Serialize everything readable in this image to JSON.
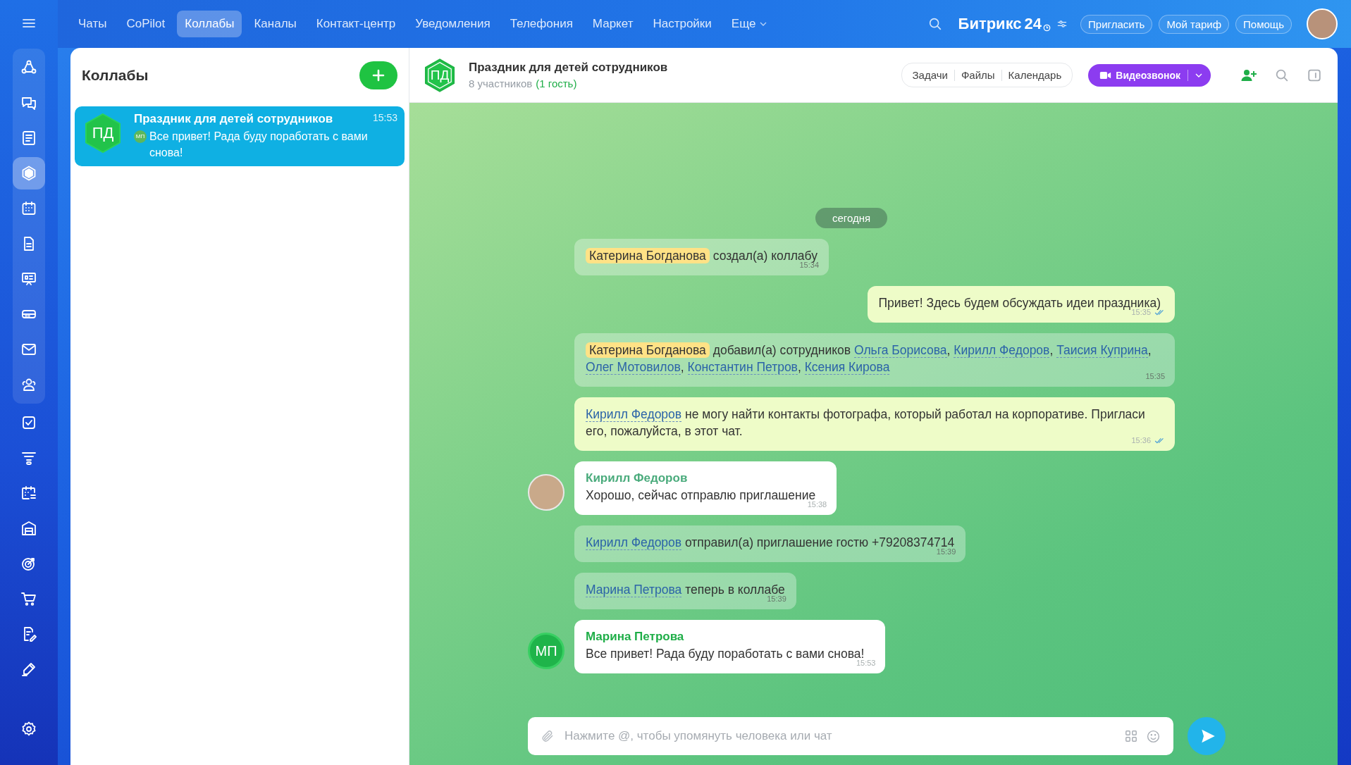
{
  "top_nav": {
    "tabs": [
      {
        "label": "Чаты",
        "selected": false,
        "kind": "link"
      },
      {
        "label": "CoPilot",
        "selected": false,
        "kind": "link"
      },
      {
        "label": "Коллабы",
        "selected": true,
        "kind": "link"
      },
      {
        "label": "Каналы",
        "selected": false,
        "kind": "link"
      },
      {
        "label": "Контакт-центр",
        "selected": false,
        "kind": "link"
      },
      {
        "label": "Уведомления",
        "selected": false,
        "kind": "link"
      },
      {
        "label": "Телефония",
        "selected": false,
        "kind": "link"
      },
      {
        "label": "Маркет",
        "selected": false,
        "kind": "link"
      },
      {
        "label": "Настройки",
        "selected": false,
        "kind": "link"
      },
      {
        "label": "Еще",
        "selected": false,
        "kind": "menu"
      }
    ],
    "logo": "Битрикс",
    "logo_suffix": "24",
    "buttons": [
      "Пригласить",
      "Мой тариф",
      "Помощь"
    ]
  },
  "sidebar": {
    "items": [
      {
        "selected": false
      },
      {
        "selected": false
      },
      {
        "selected": false
      },
      {
        "selected": true
      },
      {
        "selected": false
      },
      {
        "selected": false
      },
      {
        "selected": false
      },
      {
        "selected": false
      },
      {
        "selected": false
      },
      {
        "selected": false
      },
      {
        "selected": false
      },
      {
        "selected": false
      },
      {
        "selected": false
      },
      {
        "selected": false
      },
      {
        "selected": false
      },
      {
        "selected": false
      },
      {
        "selected": false
      },
      {
        "selected": false
      }
    ]
  },
  "chat_list": {
    "title": "Коллабы",
    "chats": [
      {
        "initials": "ПД",
        "title": "Праздник для детей сотрудников",
        "time": "15:53",
        "sender_initials": "МП",
        "preview": "Все привет! Рада буду поработать с вами снова!",
        "selected": true
      }
    ]
  },
  "chat": {
    "initials": "ПД",
    "title": "Праздник для детей сотрудников",
    "members": "8 участников",
    "guests": "(1 гость)",
    "tabs": [
      "Задачи",
      "Файлы",
      "Календарь"
    ],
    "call_button": "Видеозвонок",
    "date": "сегодня",
    "messages": [
      {
        "kind": "system",
        "time": "15:34",
        "parts": [
          {
            "kind": "highlight",
            "text": "Катерина Богданова"
          },
          {
            "kind": "plain",
            "text": " создал(а) коллабу"
          }
        ]
      },
      {
        "kind": "own",
        "time": "15:35",
        "read": true,
        "parts": [
          {
            "kind": "plain",
            "text": "Привет! Здесь будем обсуждать идеи праздника)"
          }
        ]
      },
      {
        "kind": "system",
        "time": "15:35",
        "parts": [
          {
            "kind": "highlight",
            "text": "Катерина Богданова"
          },
          {
            "kind": "plain",
            "text": " добавил(а) сотрудников "
          },
          {
            "kind": "mention",
            "text": "Ольга Борисова"
          },
          {
            "kind": "plain",
            "text": ", "
          },
          {
            "kind": "mention",
            "text": "Кирилл Федоров"
          },
          {
            "kind": "plain",
            "text": ", "
          },
          {
            "kind": "mention",
            "text": "Таисия Куприна"
          },
          {
            "kind": "plain",
            "text": ", "
          },
          {
            "kind": "mention",
            "text": "Олег Мотовилов"
          },
          {
            "kind": "plain",
            "text": ", "
          },
          {
            "kind": "mention",
            "text": "Константин Петров"
          },
          {
            "kind": "plain",
            "text": ", "
          },
          {
            "kind": "mention",
            "text": "Ксения Кирова"
          }
        ]
      },
      {
        "kind": "own",
        "time": "15:36",
        "read": true,
        "parts": [
          {
            "kind": "mention",
            "text": "Кирилл Федоров"
          },
          {
            "kind": "plain",
            "text": " не могу найти контакты фотографа, который работал на корпоративе. Пригласи его, пожалуйста, в этот чат."
          }
        ]
      },
      {
        "kind": "incoming",
        "time": "15:38",
        "author": "Кирилл Федоров",
        "color": "#4aab7c",
        "avatar": {
          "kind": "photo"
        },
        "parts": [
          {
            "kind": "plain",
            "text": "Хорошо, сейчас отправлю приглашение"
          }
        ]
      },
      {
        "kind": "system",
        "time": "15:39",
        "parts": [
          {
            "kind": "mention",
            "text": "Кирилл Федоров"
          },
          {
            "kind": "plain",
            "text": " отправил(а) приглашение гостю +79208374714"
          }
        ]
      },
      {
        "kind": "system",
        "time": "15:39",
        "parts": [
          {
            "kind": "mention",
            "text": "Марина Петрова"
          },
          {
            "kind": "plain",
            "text": " теперь в коллабе"
          }
        ]
      },
      {
        "kind": "incoming",
        "time": "15:53",
        "author": "Марина Петрова",
        "color": "#1fae48",
        "avatar": {
          "kind": "initials",
          "text": "МП"
        },
        "parts": [
          {
            "kind": "plain",
            "text": "Все привет! Рада буду поработать с вами снова!"
          }
        ]
      }
    ],
    "input": {
      "placeholder": "Нажмите @, чтобы упомянуть человека или чат"
    }
  }
}
